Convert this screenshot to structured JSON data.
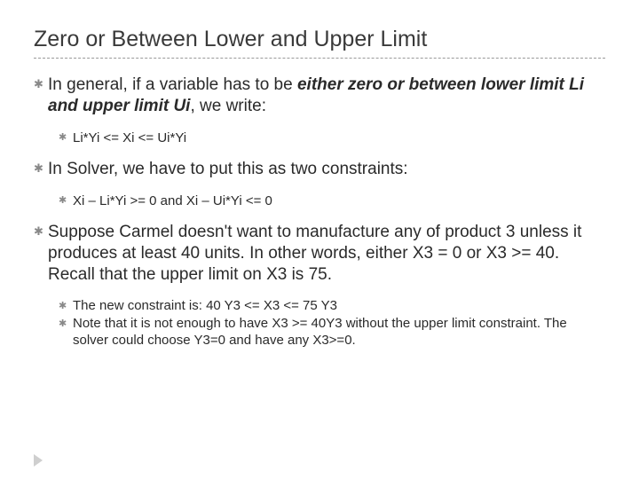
{
  "title": "Zero or Between Lower and Upper Limit",
  "b1": {
    "pre": "In general, if a variable has to be ",
    "em": "either zero or between lower limit Li and upper limit Ui",
    "post": ", we write:",
    "sub": "Li*Yi <= Xi <= Ui*Yi"
  },
  "b2": {
    "text": "In Solver, we have to put this as two constraints:",
    "sub": "Xi – Li*Yi >= 0   and   Xi – Ui*Yi <= 0"
  },
  "b3": {
    "text": "Suppose Carmel doesn't want to manufacture any of product 3 unless it produces at least 40 units.  In other words, either X3 = 0 or X3 >= 40.  Recall that the upper limit on X3 is 75.",
    "sub1": "The new constraint is:   40 Y3 <= X3 <= 75 Y3",
    "sub2": "Note that it is not enough to have X3 >= 40Y3 without the upper limit constraint.  The solver could choose Y3=0 and have any X3>=0."
  }
}
